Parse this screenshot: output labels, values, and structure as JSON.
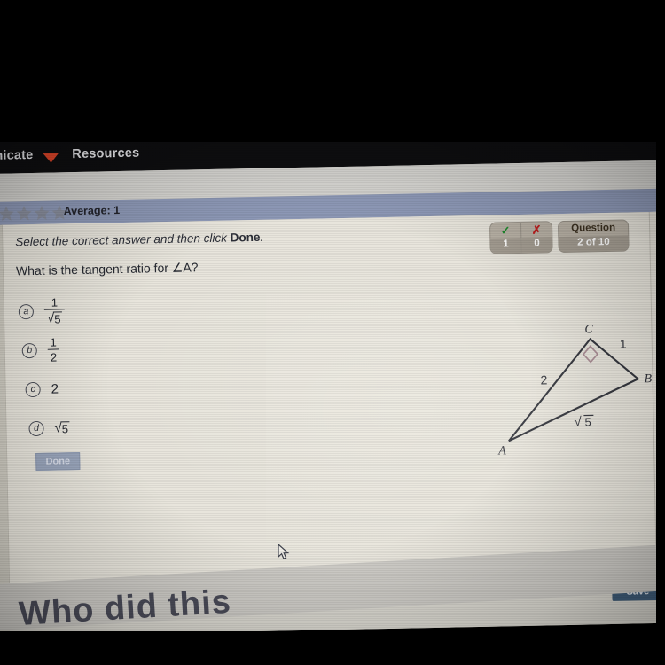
{
  "navbar": {
    "communicate_label": "nicate",
    "communicate_caret": "dropdown-caret",
    "resources_label": "Resources"
  },
  "rating": {
    "label": "Average: 1",
    "stars_total": 5,
    "stars_filled": 1,
    "filled_color": "#cf2b2b",
    "empty_color": "#8a8f9e"
  },
  "quiz": {
    "instruction_prefix": "Select the correct answer and then click ",
    "instruction_bold": "Done",
    "instruction_suffix": ".",
    "question": "What is the tangent ratio for ∠A?",
    "done_label": "Done",
    "options": [
      {
        "letter": "a",
        "kind": "fraction",
        "numerator": "1",
        "denominator_sqrt": "5",
        "text": "1/√5"
      },
      {
        "letter": "b",
        "kind": "fraction",
        "numerator": "1",
        "denominator": "2",
        "text": "1/2"
      },
      {
        "letter": "c",
        "kind": "plain",
        "value": "2",
        "text": "2"
      },
      {
        "letter": "d",
        "kind": "sqrt",
        "radicand": "5",
        "text": "√5"
      }
    ]
  },
  "score": {
    "correct_icon": "check-icon",
    "incorrect_icon": "x-icon",
    "correct_count": "1",
    "incorrect_count": "0",
    "question_label": "Question",
    "question_count": "2 of 10",
    "check_color": "#1f8b2e",
    "x_color": "#c02020"
  },
  "diagram": {
    "type": "right-triangle",
    "vertices": {
      "A": "A",
      "B": "B",
      "C": "C"
    },
    "side_AC": "2",
    "side_CB": "1",
    "side_AB": "√5",
    "right_angle_at": "C",
    "right_angle_color": "#a98b93",
    "stroke_color": "#2e3038"
  },
  "footer": {
    "save_label": "Save"
  },
  "overlay": {
    "undertext": "Who did this",
    "cursor": "mouse-pointer"
  }
}
